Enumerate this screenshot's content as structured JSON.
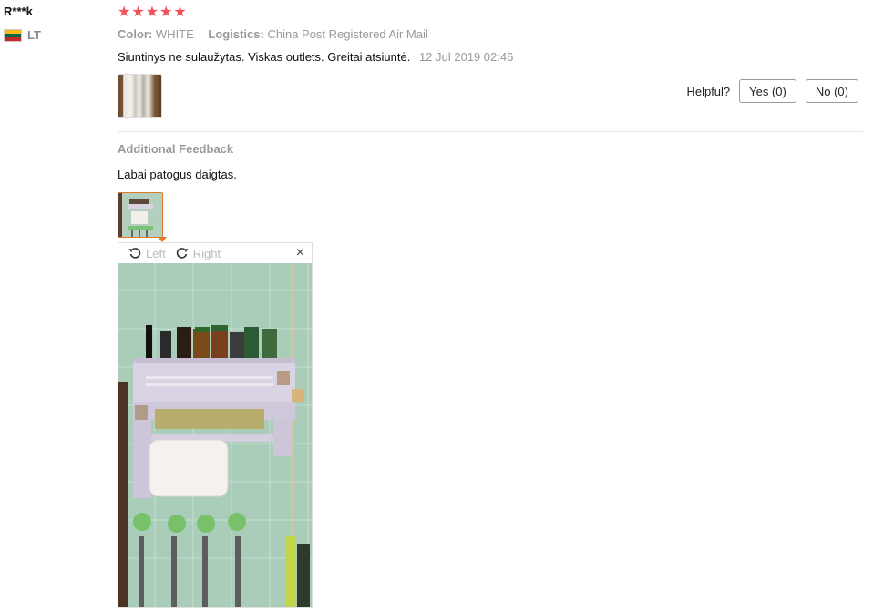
{
  "reviewer": {
    "name": "R***k",
    "country_code": "LT",
    "flag_colors": [
      "#fdb913",
      "#006a44",
      "#c1272d"
    ]
  },
  "rating": {
    "stars": 5,
    "max": 5,
    "color": "#f4505a"
  },
  "attributes": {
    "color_label": "Color:",
    "color_value": "WHITE",
    "logistics_label": "Logistics:",
    "logistics_value": "China Post Registered Air Mail"
  },
  "review": {
    "text": "Siuntinys ne sulaužytas. Viskas outlets. Greitai atsiuntė.",
    "date": "12 Jul 2019 02:46"
  },
  "helpful": {
    "label": "Helpful?",
    "yes_label": "Yes (0)",
    "no_label": "No (0)"
  },
  "additional": {
    "title": "Additional Feedback",
    "text": "Labai patogus daigtas."
  },
  "viewer": {
    "rotate_left_label": "Left",
    "rotate_right_label": "Right",
    "close_glyph": "×",
    "icons": [
      "rotate-left-icon",
      "rotate-right-icon",
      "close-icon"
    ]
  },
  "colors": {
    "accent": "#e07b2a",
    "muted": "#999999"
  }
}
